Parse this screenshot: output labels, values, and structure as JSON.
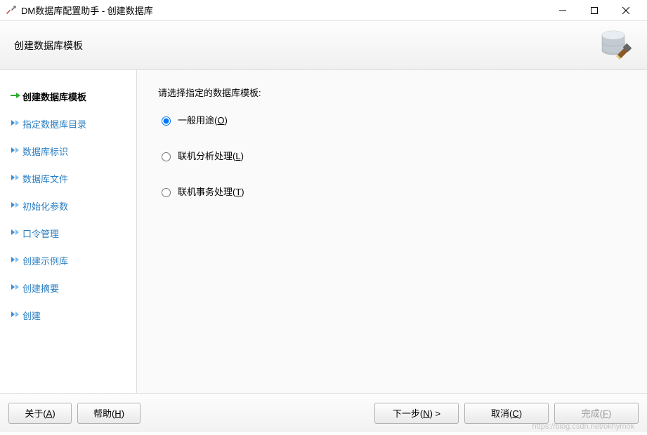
{
  "window": {
    "title": "DM数据库配置助手 - 创建数据库"
  },
  "header": {
    "title": "创建数据库模板"
  },
  "sidebar": {
    "steps": [
      {
        "label": "创建数据库模板",
        "active": true
      },
      {
        "label": "指定数据库目录",
        "active": false
      },
      {
        "label": "数据库标识",
        "active": false
      },
      {
        "label": "数据库文件",
        "active": false
      },
      {
        "label": "初始化参数",
        "active": false
      },
      {
        "label": "口令管理",
        "active": false
      },
      {
        "label": "创建示例库",
        "active": false
      },
      {
        "label": "创建摘要",
        "active": false
      },
      {
        "label": "创建",
        "active": false
      }
    ]
  },
  "content": {
    "prompt": "请选择指定的数据库模板:",
    "options": [
      {
        "text": "一般用途",
        "accel": "O",
        "checked": true
      },
      {
        "text": "联机分析处理",
        "accel": "L",
        "checked": false
      },
      {
        "text": "联机事务处理",
        "accel": "T",
        "checked": false
      }
    ]
  },
  "footer": {
    "about": "关于(A)",
    "help": "帮助(H)",
    "next": "下一步(N) >",
    "cancel": "取消(C)",
    "finish": "完成(F)"
  },
  "watermark": "https://blog.csdn.net/okhymok"
}
